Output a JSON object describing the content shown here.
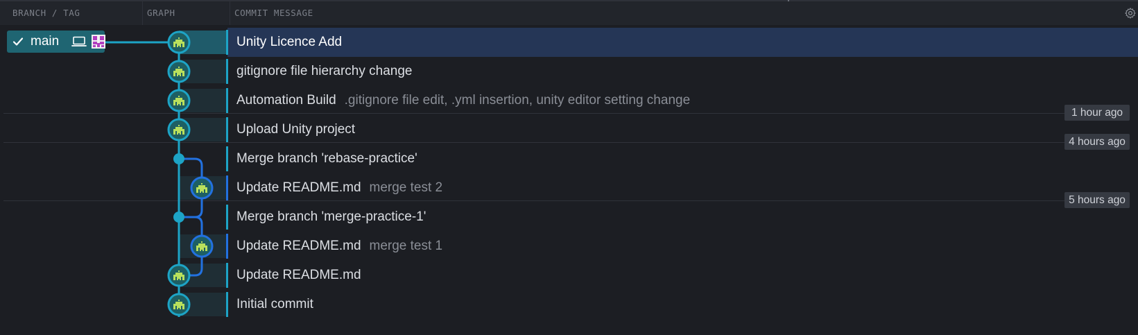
{
  "header": {
    "col_branch": "BRANCH / TAG",
    "col_graph": "GRAPH",
    "col_message": "COMMIT MESSAGE",
    "settings_icon": "gear-icon"
  },
  "branch": {
    "name": "main",
    "checked_icon": "check-icon",
    "local_icon": "laptop-icon",
    "avatar_icon": "avatar-icon"
  },
  "commits": [
    {
      "message": "Unity Licence Add",
      "description": ""
    },
    {
      "message": "gitignore file hierarchy change",
      "description": ""
    },
    {
      "message": "Automation Build",
      "description": ".gitignore file edit, .yml insertion, unity editor setting change"
    },
    {
      "message": "Upload Unity project",
      "description": ""
    },
    {
      "message": "Merge branch 'rebase-practice'",
      "description": ""
    },
    {
      "message": "Update README.md",
      "description": "merge test 2"
    },
    {
      "message": "Merge branch 'merge-practice-1'",
      "description": ""
    },
    {
      "message": "Update README.md",
      "description": "merge test 1"
    },
    {
      "message": "Update README.md",
      "description": ""
    },
    {
      "message": "Initial commit",
      "description": ""
    }
  ],
  "time_groups": [
    {
      "label": "1 hour ago"
    },
    {
      "label": "4 hours ago"
    },
    {
      "label": "5 hours ago"
    }
  ],
  "colors": {
    "main_lane": "#1da4c6",
    "branch_lane": "#2271e0",
    "selected_row": "#253656",
    "avatar_bg": "#1e5f63",
    "avatar_fg": "#b9e05c"
  }
}
